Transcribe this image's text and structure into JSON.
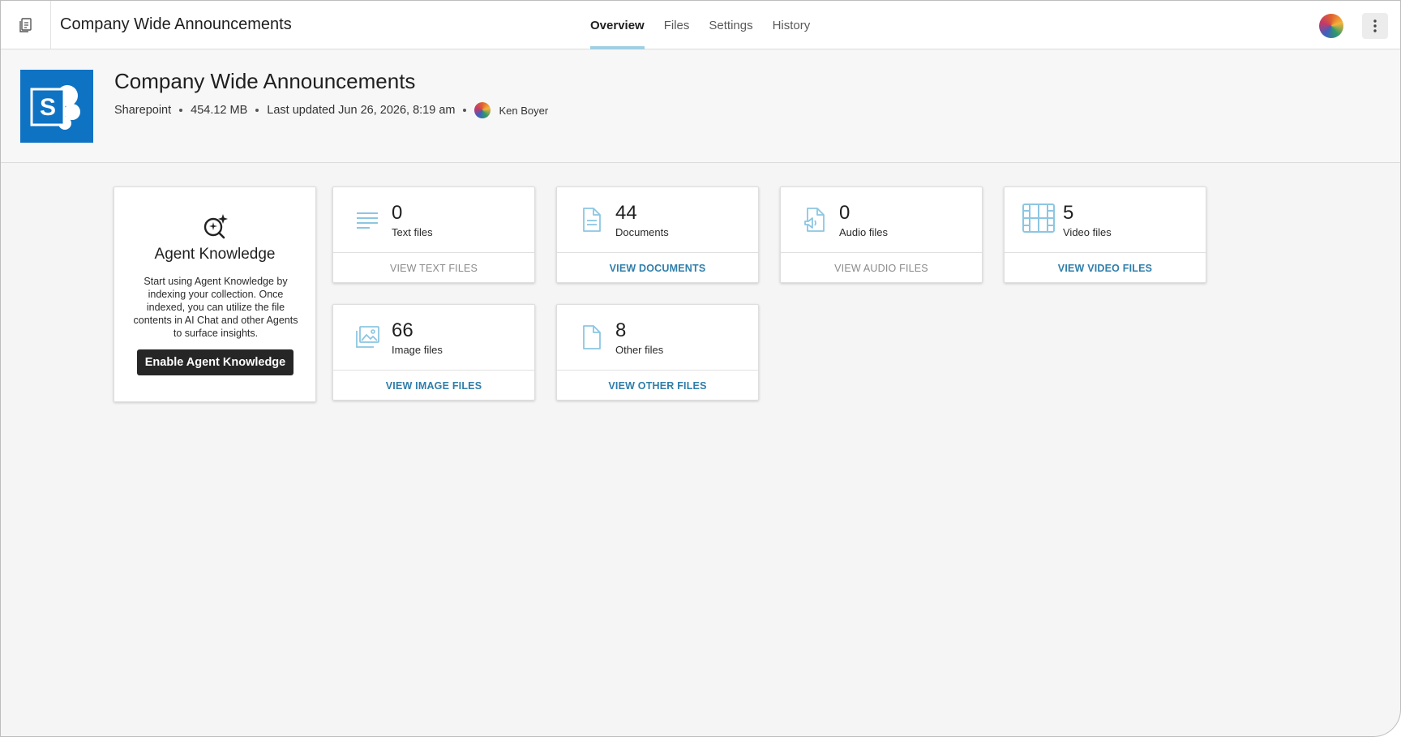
{
  "app": {
    "title": "Company Wide Announcements"
  },
  "tabs": [
    {
      "label": "Overview",
      "active": true
    },
    {
      "label": "Files",
      "active": false
    },
    {
      "label": "Settings",
      "active": false
    },
    {
      "label": "History",
      "active": false
    }
  ],
  "header": {
    "title": "Company Wide Announcements",
    "source": "Sharepoint",
    "size": "454.12 MB",
    "updated": "Last updated Jun 26, 2026, 8:19 am",
    "owner": "Ken Boyer",
    "logo_letter": "S"
  },
  "agent": {
    "title": "Agent Knowledge",
    "description": "Start using Agent Knowledge by indexing your collection. Once indexed, you can utilize the file contents in AI Chat and other Agents to surface insights.",
    "button": "Enable Agent Knowledge"
  },
  "stats": {
    "text": {
      "count": "0",
      "label": "Text files",
      "link": "VIEW TEXT FILES"
    },
    "docs": {
      "count": "44",
      "label": "Documents",
      "link": "VIEW DOCUMENTS"
    },
    "audio": {
      "count": "0",
      "label": "Audio files",
      "link": "VIEW AUDIO FILES"
    },
    "video": {
      "count": "5",
      "label": "Video files",
      "link": "VIEW VIDEO FILES"
    },
    "image": {
      "count": "66",
      "label": "Image files",
      "link": "VIEW IMAGE FILES"
    },
    "other": {
      "count": "8",
      "label": "Other files",
      "link": "VIEW OTHER FILES"
    }
  },
  "colors": {
    "accent_link": "#2f7eaa",
    "tab_underline": "#9ecfe3",
    "icon": "#8cc6e2",
    "sharepoint": "#0f73c4"
  }
}
